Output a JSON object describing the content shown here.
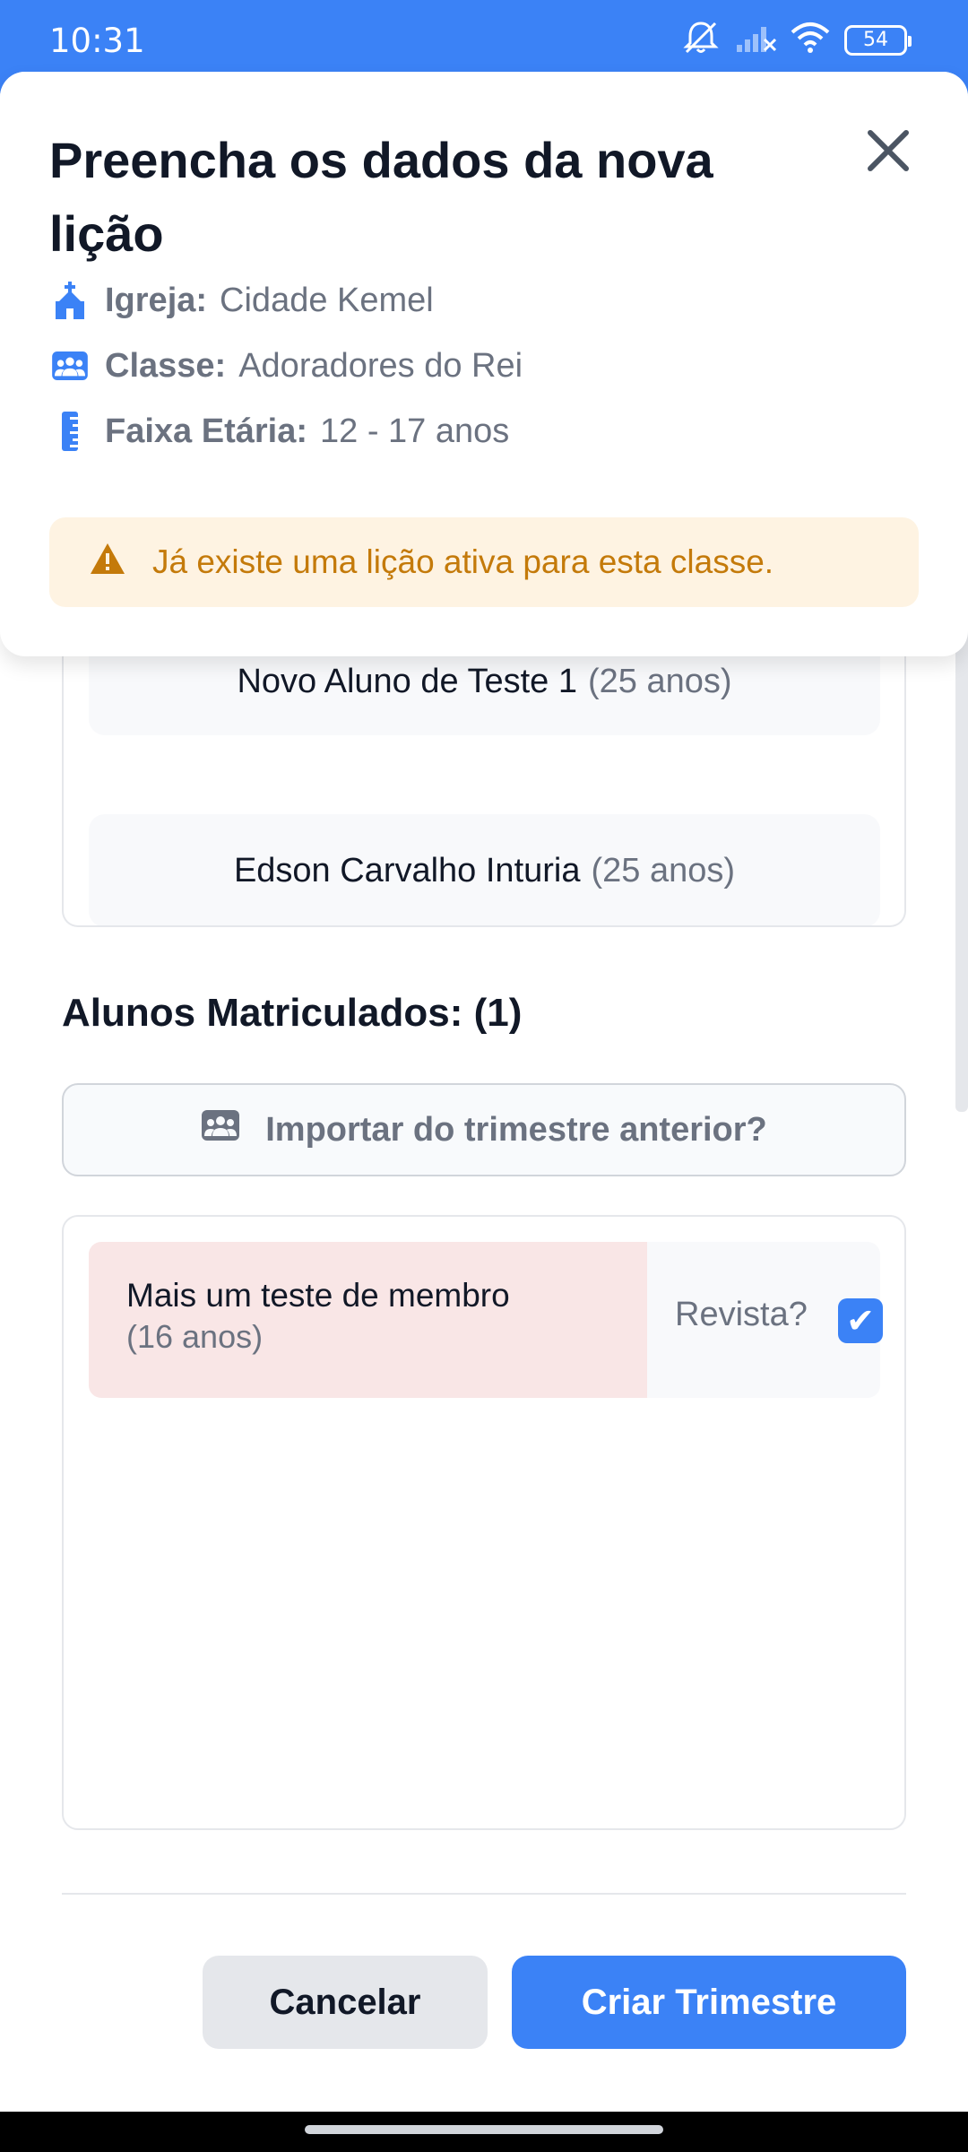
{
  "status_bar": {
    "time": "10:31",
    "battery": "54",
    "icons": [
      "mute-icon",
      "signal-icon",
      "wifi-icon",
      "battery-icon"
    ]
  },
  "header": {
    "title": "Preencha os dados da nova lição",
    "info": [
      {
        "icon": "church-icon",
        "label": "Igreja:",
        "value": "Cidade Kemel"
      },
      {
        "icon": "group-icon",
        "label": "Classe:",
        "value": "Adoradores do Rei"
      },
      {
        "icon": "ruler-icon",
        "label": "Faixa Etária:",
        "value": "12 - 17 anos"
      }
    ],
    "warning": "Já existe uma lição ativa para esta classe."
  },
  "available_students": [
    {
      "name": "Novo Aluno de Teste 1",
      "age": "(25 anos)"
    },
    {
      "name": "Edson Carvalho Inturia",
      "age": "(25 anos)"
    }
  ],
  "enrolled": {
    "title": "Alunos Matriculados: (1)",
    "import_label": "Importar do trimestre anterior?",
    "members": [
      {
        "name": "Mais um teste de membro",
        "age": "(16 anos)",
        "revista_label": "Revista?",
        "revista_checked": true
      }
    ]
  },
  "footer": {
    "cancel_label": "Cancelar",
    "create_label": "Criar Trimestre"
  },
  "colors": {
    "accent": "#3b82f6",
    "warning_bg": "#fef3e2",
    "warning_text": "#c47a0a",
    "member_highlight": "#f9e6e6"
  }
}
